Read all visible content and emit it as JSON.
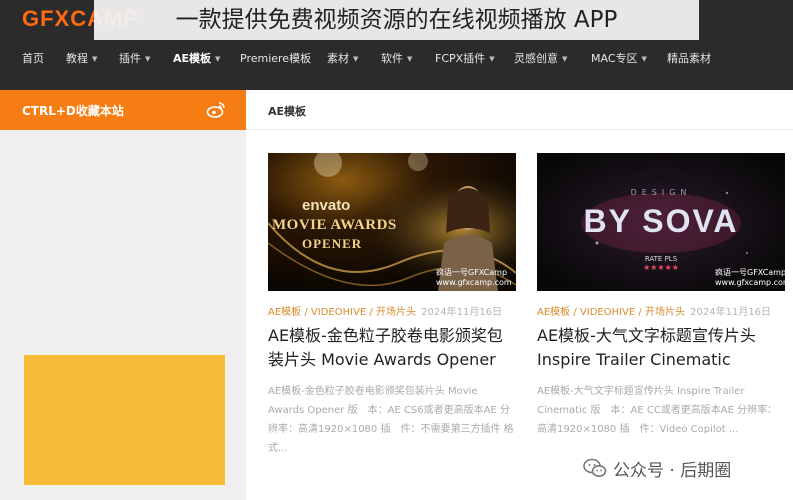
{
  "banner": {
    "text": "一款提供免费视频资源的在线视频播放 APP"
  },
  "site": {
    "logo": "GFXCAMP"
  },
  "nav": {
    "items": [
      {
        "label": "首页",
        "dropdown": false
      },
      {
        "label": "教程",
        "dropdown": true
      },
      {
        "label": "插件",
        "dropdown": true
      },
      {
        "label": "AE模板",
        "dropdown": true,
        "active": true
      },
      {
        "label": "Premiere模板",
        "dropdown": false
      },
      {
        "label": "素材",
        "dropdown": true
      },
      {
        "label": "软件",
        "dropdown": true
      },
      {
        "label": "FCPX插件",
        "dropdown": true
      },
      {
        "label": "灵感创意",
        "dropdown": true
      },
      {
        "label": "MAC专区",
        "dropdown": true
      },
      {
        "label": "精品素材",
        "dropdown": false
      }
    ]
  },
  "sidebar": {
    "bookmark_label": "CTRL+D收藏本站",
    "weibo_icon": "weibo-icon"
  },
  "main": {
    "section_title": "AE模板",
    "cards": [
      {
        "thumb_brand": "envato",
        "thumb_title_1": "MOVIE AWARDS",
        "thumb_title_2": "OPENER",
        "watermark_1": "疯语一号GFXCamp",
        "watermark_2": "www.gfxcamp.com",
        "tags": [
          "AE模板",
          "VIDEOHIVE",
          "开场片头"
        ],
        "date": "2024年11月16日",
        "title": "AE模板-金色粒子胶卷电影颁奖包装片头 Movie Awards Opener",
        "desc": "AE模板-金色粒子胶卷电影颁奖包装片头 Movie Awards Opener 版　本：AE CS6或者更高版本AE 分辨率：高清1920×1080 插　件：不需要第三方插件 格　式..."
      },
      {
        "thumb_kicker": "DESIGN",
        "thumb_title": "BY SOVA",
        "thumb_rate": "RATE PLS",
        "thumb_stars": "★★★★★",
        "watermark_1": "疯语一号GFXCamp",
        "watermark_2": "www.gfxcamp.com",
        "tags": [
          "AE模板",
          "VIDEOHIVE",
          "开场片头"
        ],
        "date": "2024年11月16日",
        "title": "AE模板-大气文字标题宣传片头 Inspire Trailer Cinematic",
        "desc": "AE模板-大气文字标题宣传片头 Inspire Trailer Cinematic 版　本：AE CC或者更高版本AE 分辨率：高清1920×1080 插　件：Video Copilot ..."
      }
    ]
  },
  "watermark": {
    "text": "公众号 · 后期圈"
  },
  "colors": {
    "accent": "#f57d14",
    "nav_bg": "#2b2b2b",
    "tag": "#d98a2a"
  }
}
